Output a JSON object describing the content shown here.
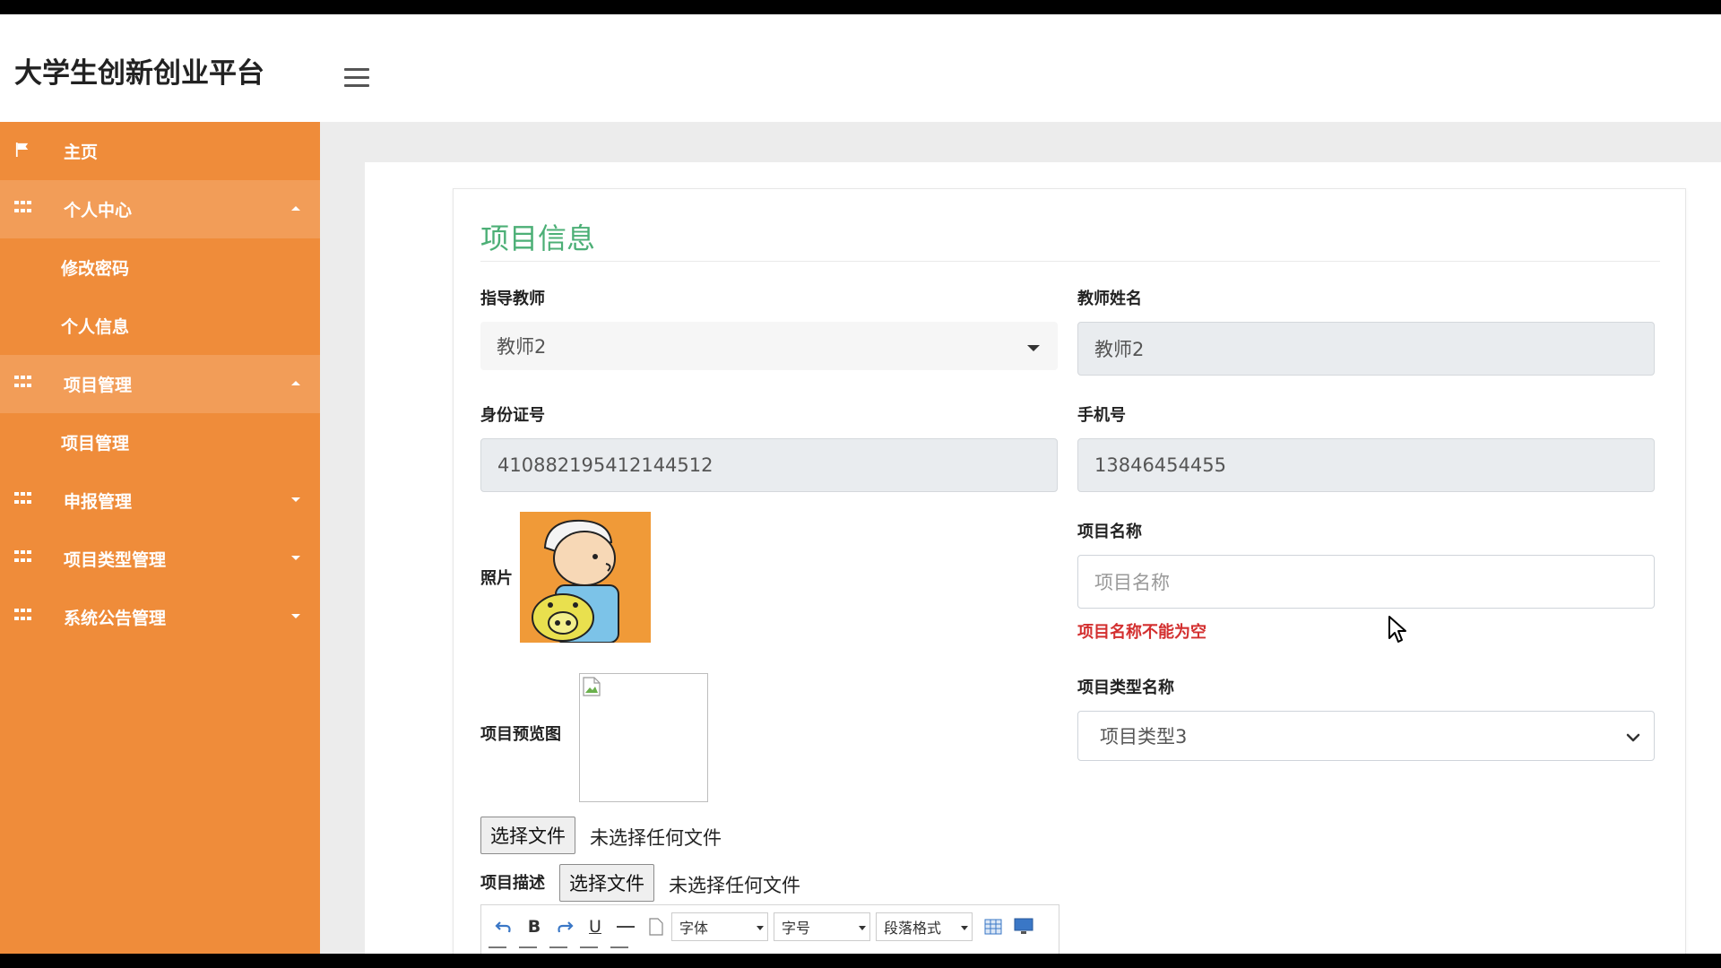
{
  "header": {
    "brand": "大学生创新创业平台"
  },
  "sidebar": {
    "home": "主页",
    "personal_center": {
      "label": "个人中心",
      "children": [
        "修改密码",
        "个人信息"
      ]
    },
    "project_mgmt": {
      "label": "项目管理",
      "children": [
        "项目管理"
      ]
    },
    "report_mgmt": "申报管理",
    "project_type_mgmt": "项目类型管理",
    "announcement_mgmt": "系统公告管理"
  },
  "card": {
    "title": "项目信息",
    "teacher": {
      "label": "指导教师",
      "value": "教师2"
    },
    "teacher_name": {
      "label": "教师姓名",
      "value": "教师2"
    },
    "id_number": {
      "label": "身份证号",
      "value": "410882195412144512"
    },
    "phone": {
      "label": "手机号",
      "value": "13846454455"
    },
    "photo": {
      "label": "照片"
    },
    "project_name": {
      "label": "项目名称",
      "placeholder": "项目名称",
      "error": "项目名称不能为空"
    },
    "preview": {
      "label": "项目预览图",
      "button": "选择文件",
      "status": "未选择任何文件"
    },
    "project_type": {
      "label": "项目类型名称",
      "value": "项目类型3"
    },
    "description": {
      "label": "项目描述",
      "button": "选择文件",
      "status": "未选择任何文件"
    },
    "editor": {
      "font": "字体",
      "size": "字号",
      "paragraph": "段落格式"
    }
  },
  "colors": {
    "sidebar": "#ef8c3a",
    "title": "#4caf76",
    "error": "#d32f2f"
  }
}
